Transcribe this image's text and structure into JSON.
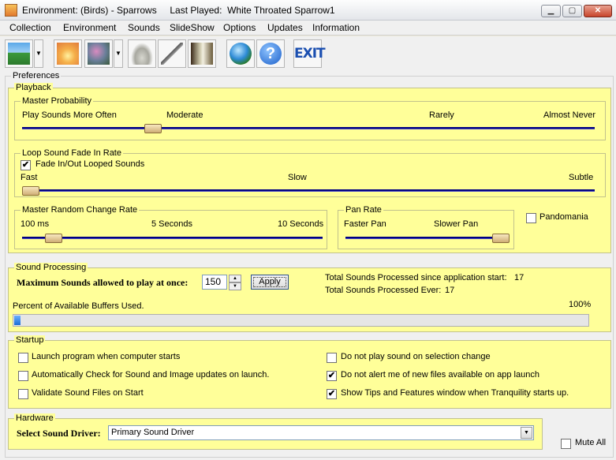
{
  "window": {
    "title": "Environment: (Birds) - Sparrows     Last Played:  White Throated Sparrow1",
    "buttons": {
      "minimize": "▁",
      "maximize": "▢",
      "close": "✕"
    }
  },
  "menu": [
    "Collection",
    "Environment",
    "Sounds",
    "SlideShow",
    "Options",
    "Updates",
    "Information"
  ],
  "toolbar": {
    "exit_label": "EXIT",
    "help_label": "?",
    "dropdown_glyph": "▼"
  },
  "preferences": {
    "title": "Preferences",
    "playback": {
      "title": "Playback",
      "master_probability": {
        "title": "Master Probability",
        "labels": [
          "Play Sounds More Often",
          "Moderate",
          "Rarely",
          "Almost Never"
        ],
        "value": 0.22
      },
      "loop_fade": {
        "title": "Loop Sound Fade In Rate",
        "checkbox_label": "Fade In/Out Looped Sounds",
        "checked": true,
        "labels": [
          "Fast",
          "Slow",
          "Subtle"
        ],
        "value": 0.0
      },
      "random_change": {
        "title": "Master Random Change Rate",
        "labels": [
          "100 ms",
          "5 Seconds",
          "10 Seconds"
        ],
        "value": 0.08
      },
      "pan_rate": {
        "title": "Pan Rate",
        "labels": [
          "Faster Pan",
          "Slower Pan"
        ],
        "value": 1.0
      },
      "pandomania": {
        "label": "Pandomania",
        "checked": false
      }
    },
    "sound_processing": {
      "title": "Sound Processing",
      "max_sounds_label": "Maximum Sounds allowed to play at once:",
      "max_sounds_value": "150",
      "apply_label": "Apply",
      "total_since_start_label": "Total Sounds Processed since application start:",
      "total_since_start_value": "17",
      "total_ever_label": "Total Sounds Processed Ever:",
      "total_ever_value": "17",
      "buffers_label": "Percent of Available Buffers Used.",
      "buffers_percent_label": "100%",
      "buffers_fill": 0.01
    },
    "startup": {
      "title": "Startup",
      "left": [
        {
          "label": "Launch program when computer starts",
          "checked": false
        },
        {
          "label": "Automatically Check for Sound and Image updates on launch.",
          "checked": false
        },
        {
          "label": "Validate Sound Files on Start",
          "checked": false
        }
      ],
      "right": [
        {
          "label": "Do not play sound on selection change",
          "checked": false
        },
        {
          "label": "Do not alert me of new files available on app launch",
          "checked": true
        },
        {
          "label": "Show Tips and Features window when Tranquility starts up.",
          "checked": true
        }
      ]
    },
    "hardware": {
      "title": "Hardware",
      "driver_label": "Select Sound Driver:",
      "driver_value": "Primary Sound Driver"
    },
    "mute_all": {
      "label": "Mute All",
      "checked": false
    }
  },
  "colors": {
    "panel": "#ffff99",
    "track": "#000080",
    "progress": "#1f6fd6"
  }
}
